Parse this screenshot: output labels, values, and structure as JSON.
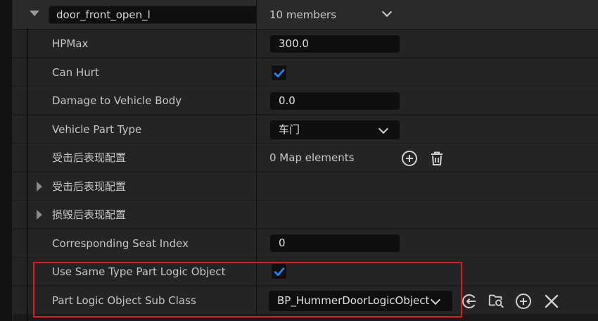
{
  "header": {
    "name_value": "door_front_open_l",
    "members_label": "10 members"
  },
  "rows": {
    "hpmax": {
      "label": "HPMax",
      "value": "300.0"
    },
    "can_hurt": {
      "label": "Can Hurt",
      "checked": true
    },
    "damage": {
      "label": "Damage to Vehicle Body",
      "value": "0.0"
    },
    "part_type": {
      "label": "Vehicle Part Type",
      "value": "车门"
    },
    "hit_config_map": {
      "label": "受击后表现配置",
      "value": "0 Map elements"
    },
    "hit_config": {
      "label": "受击后表现配置"
    },
    "destroy_config": {
      "label": "损毁后表现配置"
    },
    "seat_index": {
      "label": "Corresponding Seat Index",
      "value": "0"
    },
    "same_type_logic": {
      "label": "Use Same Type Part Logic Object",
      "checked": true
    },
    "logic_sub_class": {
      "label": "Part Logic Object Sub Class",
      "value": "BP_HummerDoorLogicObject"
    }
  },
  "icons": {
    "add": "add-circle-icon",
    "delete": "trash-icon",
    "use_selected": "arrow-left-circle-icon",
    "browse": "folder-search-icon",
    "clear": "close-icon"
  },
  "colors": {
    "accent_check": "#1a8cff",
    "highlight": "#e0191f"
  }
}
